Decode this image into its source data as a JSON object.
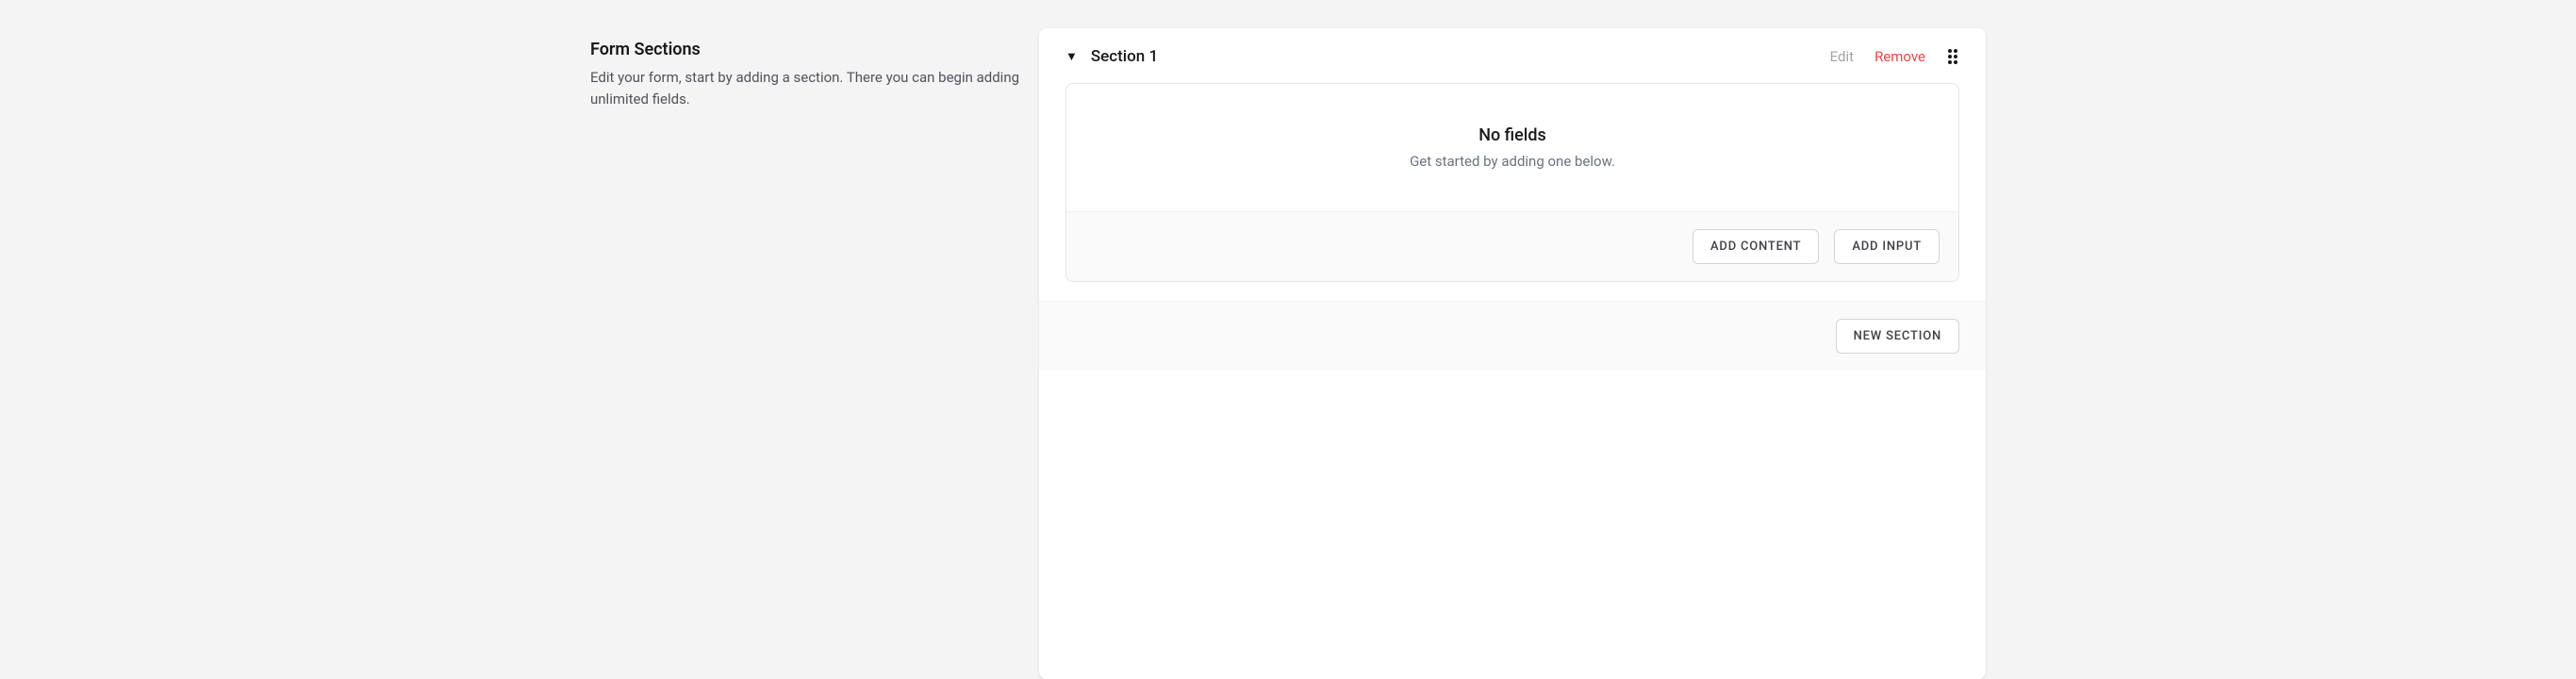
{
  "sidebar": {
    "title": "Form Sections",
    "description": "Edit your form, start by adding a section. There you can begin adding unlimited fields."
  },
  "section": {
    "title": "Section 1",
    "edit_label": "Edit",
    "remove_label": "Remove",
    "empty_title": "No fields",
    "empty_subtitle": "Get started by adding one below.",
    "add_content_label": "ADD CONTENT",
    "add_input_label": "ADD INPUT"
  },
  "footer": {
    "new_section_label": "NEW SECTION"
  }
}
